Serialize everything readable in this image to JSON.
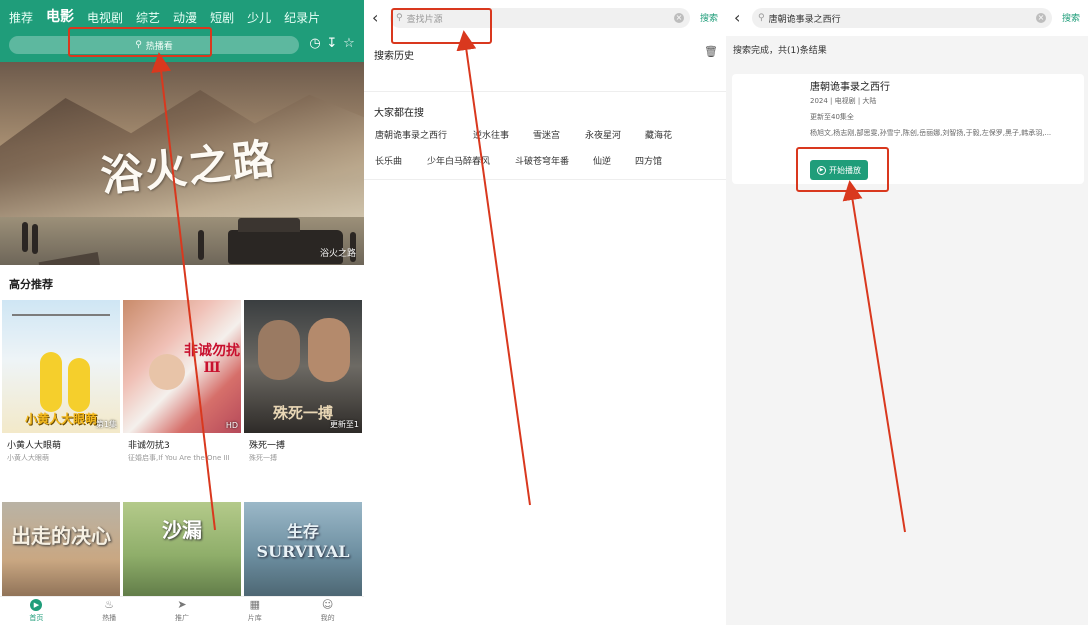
{
  "panel1": {
    "tabs": [
      "推荐",
      "电影",
      "电视剧",
      "综艺",
      "动漫",
      "短剧",
      "少儿",
      "纪录片"
    ],
    "active_tab_index": 1,
    "search_placeholder": "热播看",
    "banner_title": "浴火之路",
    "banner_caption": "浴火之路",
    "section_title": "高分推荐",
    "cards": [
      {
        "title": "小黄人大眼萌",
        "sub": "小黄人大眼萌",
        "badge": "第1集",
        "poster_text": "小黄人大眼萌"
      },
      {
        "title": "非诚勿扰3",
        "sub": "征婚启事,If You Are the One III",
        "badge": "HD",
        "poster_text": "非诚勿扰Ⅲ"
      },
      {
        "title": "殊死一搏",
        "sub": "殊死一搏",
        "badge": "更新至1",
        "poster_text": "殊死一搏"
      }
    ],
    "row2_posters": [
      {
        "poster_text": "出走的决心"
      },
      {
        "poster_text": "沙漏"
      },
      {
        "poster_text": "生存 SURVIVAL"
      }
    ],
    "nav": [
      {
        "label": "首页",
        "icon": "home-icon",
        "active": true
      },
      {
        "label": "热播",
        "icon": "flame-icon",
        "active": false
      },
      {
        "label": "推广",
        "icon": "send-icon",
        "active": false
      },
      {
        "label": "片库",
        "icon": "grid-icon",
        "active": false
      },
      {
        "label": "我的",
        "icon": "smile-icon",
        "active": false
      }
    ]
  },
  "panel2": {
    "search_placeholder": "查找片源",
    "search_button": "搜索",
    "history_title": "搜索历史",
    "hot_title": "大家都在搜",
    "hot_items": [
      [
        "唐朝诡事录之西行",
        "逆水往事",
        "雪迷宫",
        "永夜星河",
        "藏海花"
      ],
      [
        "长乐曲",
        "少年白马醉春风",
        "斗破苍穹年番",
        "仙逆",
        "四方馆"
      ]
    ]
  },
  "panel3": {
    "search_value": "唐朝诡事录之西行",
    "search_button": "搜索",
    "result_info": "搜索完成，共(1)条结果",
    "result": {
      "title": "唐朝诡事录之西行",
      "meta1": "2024 | 电视剧 | 大陆",
      "meta2": "更新至40集全",
      "meta3": "杨旭文,杨志刚,郜思雯,孙雪宁,陈创,岳丽娜,刘智扬,于毅,左保罗,黑子,韩承羽,...",
      "play_label": "开始播放"
    }
  },
  "colors": {
    "brand_green": "#1f9d7a",
    "highlight_red": "#d9381e"
  }
}
